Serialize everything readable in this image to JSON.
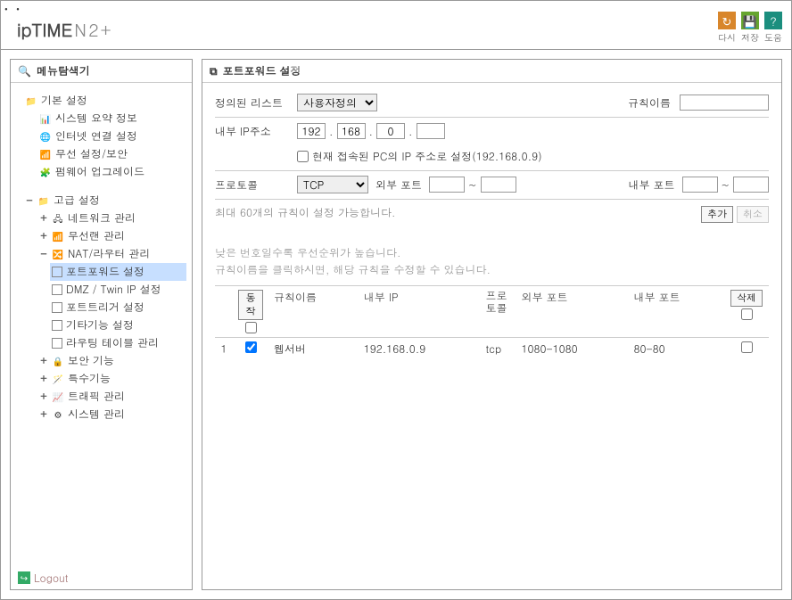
{
  "logo_main": "ipTIME",
  "logo_sub": "N2+",
  "actions": {
    "refresh": "다시",
    "save": "저장",
    "help": "도움"
  },
  "sidebar_title": "메뉴탐색기",
  "logout": "Logout",
  "tree": {
    "basic": "기본 설정",
    "sysinfo": "시스템 요약 정보",
    "wan": "인터넷 연결 설정",
    "wifi": "무선 설정/보안",
    "fw": "펌웨어 업그레이드",
    "adv": "고급 설정",
    "net": "네트워크 관리",
    "wlan": "무선랜 관리",
    "nat": "NAT/라우터 관리",
    "pf": "포트포워드 설정",
    "dmz": "DMZ / Twin IP 설정",
    "pt": "포트트리거 설정",
    "misc": "기타기능 설정",
    "route": "라우팅 테이블 관리",
    "sec": "보안 기능",
    "special": "특수기능",
    "traffic": "트래픽 관리",
    "sys": "시스템 관리"
  },
  "main_title": "포트포워드 설정",
  "form": {
    "predef": "정의된 리스트",
    "predef_sel": "사용자정의",
    "rulename": "규칙이름",
    "intip": "내부 IP주소",
    "ip1": "192",
    "ip2": "168",
    "ip3": "0",
    "ip4": "",
    "curip_chk": "현재 접속된 PC의 IP 주소로 설정(192.168.0.9)",
    "proto": "프로토콜",
    "proto_sel": "TCP",
    "extport": "외부 포트",
    "intport": "내부 포트",
    "hint60": "최대 60개의 규칙이 설정 가능합니다.",
    "add": "추가",
    "cancel": "취소"
  },
  "table": {
    "hint1": "낮은 번호일수록 우선순위가 높습니다.",
    "hint2": "규칙이름을 클릭하시면, 해당 규칙을 수정할 수 있습니다.",
    "h_action": "동작",
    "h_rule": "규칙이름",
    "h_intip": "내부 IP",
    "h_proto": "프로토콜",
    "h_extport": "외부 포트",
    "h_intport": "내부 포트",
    "h_delete": "삭제",
    "rows": [
      {
        "n": "1",
        "active": true,
        "rule": "웹서버",
        "ip": "192.168.0.9",
        "proto": "tcp",
        "ext": "1080-1080",
        "int": "80-80"
      }
    ]
  }
}
